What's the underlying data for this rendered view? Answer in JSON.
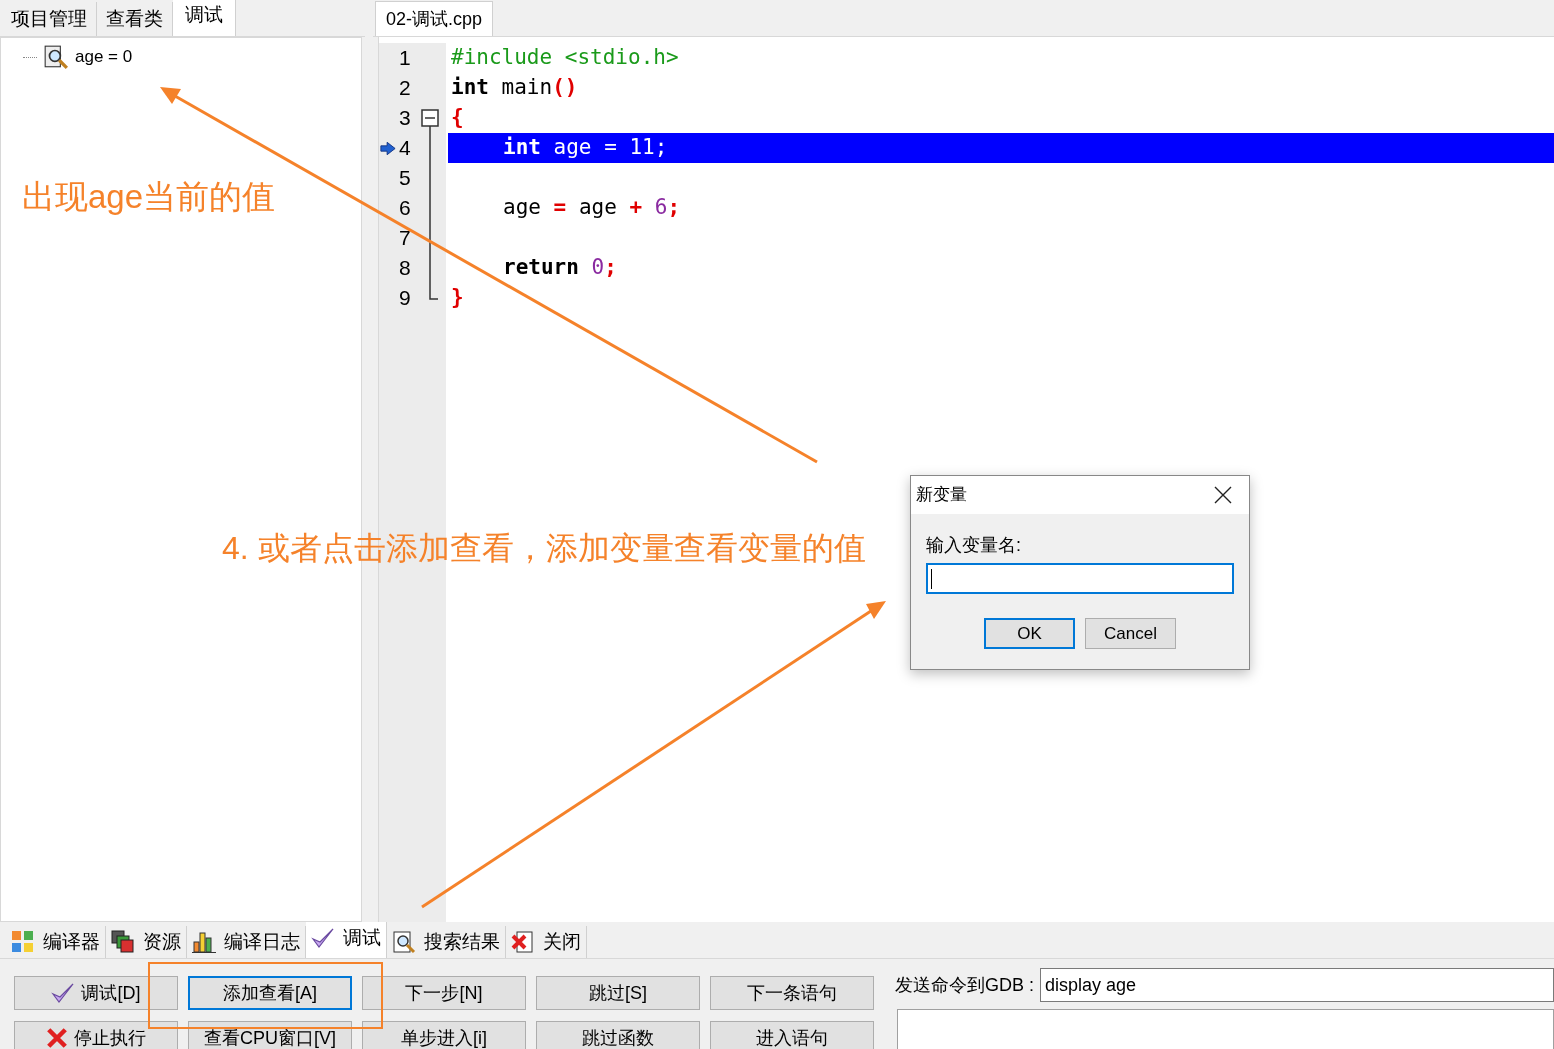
{
  "left_panel": {
    "tabs": [
      {
        "label": "项目管理",
        "selected": false
      },
      {
        "label": "查看类",
        "selected": false
      },
      {
        "label": "调试",
        "selected": true
      }
    ],
    "watch_items": [
      {
        "label": "age = 0"
      }
    ]
  },
  "editor": {
    "tabs": [
      {
        "label": "02-调试.cpp",
        "selected": true
      }
    ],
    "lines": [
      {
        "number": "1",
        "selected": false,
        "tokens": [
          {
            "text": "#include <stdio.h>",
            "kind": "preprocessor"
          }
        ]
      },
      {
        "number": "2",
        "selected": false,
        "tokens": [
          {
            "text": "int",
            "kind": "keyword"
          },
          {
            "text": " main",
            "kind": "plain"
          },
          {
            "text": "()",
            "kind": "operator"
          }
        ]
      },
      {
        "number": "3",
        "selected": false,
        "tokens": [
          {
            "text": "{",
            "kind": "operator"
          }
        ]
      },
      {
        "number": "4",
        "selected": true,
        "indented": true,
        "tokens": [
          {
            "text": "int",
            "kind": "keyword"
          },
          {
            "text": " age ",
            "kind": "plain"
          },
          {
            "text": "=",
            "kind": "operator"
          },
          {
            "text": " 11",
            "kind": "number"
          },
          {
            "text": ";",
            "kind": "operator"
          }
        ]
      },
      {
        "number": "5",
        "selected": false
      },
      {
        "number": "6",
        "selected": false,
        "indented": true,
        "tokens": [
          {
            "text": "age ",
            "kind": "plain"
          },
          {
            "text": "=",
            "kind": "operator"
          },
          {
            "text": " age ",
            "kind": "plain"
          },
          {
            "text": "+",
            "kind": "operator"
          },
          {
            "text": " 6",
            "kind": "number"
          },
          {
            "text": ";",
            "kind": "operator"
          }
        ]
      },
      {
        "number": "7",
        "selected": false
      },
      {
        "number": "8",
        "selected": false,
        "indented": true,
        "tokens": [
          {
            "text": "return",
            "kind": "keyword"
          },
          {
            "text": " 0",
            "kind": "number"
          },
          {
            "text": ";",
            "kind": "operator"
          }
        ]
      },
      {
        "number": "9",
        "selected": false,
        "tokens": [
          {
            "text": "}",
            "kind": "operator"
          }
        ]
      }
    ]
  },
  "bottom_panel": {
    "tabs": [
      {
        "label": "编译器",
        "selected": false
      },
      {
        "label": "资源",
        "selected": false
      },
      {
        "label": "编译日志",
        "selected": false
      },
      {
        "label": "调试",
        "selected": true
      },
      {
        "label": "搜索结果",
        "selected": false
      },
      {
        "label": "关闭",
        "selected": false
      }
    ],
    "button_rows": [
      [
        {
          "label": "调试[D]",
          "focused": false
        },
        {
          "label": "添加查看[A]",
          "focused": true
        },
        {
          "label": "下一步[N]",
          "focused": false
        },
        {
          "label": "跳过[S]",
          "focused": false
        },
        {
          "label": "下一条语句",
          "focused": false
        }
      ],
      [
        {
          "label": "停止执行",
          "focused": false
        },
        {
          "label": "查看CPU窗口[V]",
          "focused": false
        },
        {
          "label": "单步进入[i]",
          "focused": false
        },
        {
          "label": "跳过函数",
          "focused": false
        },
        {
          "label": "进入语句",
          "focused": false
        }
      ]
    ],
    "gdb": {
      "label": "发送命令到GDB :",
      "value": "display age"
    }
  },
  "dialog": {
    "title": "新变量",
    "label": "输入变量名:",
    "buttons": [
      {
        "label": "OK",
        "default": true
      },
      {
        "label": "Cancel",
        "default": false
      }
    ]
  },
  "annotations": [
    {
      "text": "出现age当前的值"
    },
    {
      "text": "4. 或者点击添加查看，添加变量查看变量的值"
    }
  ]
}
